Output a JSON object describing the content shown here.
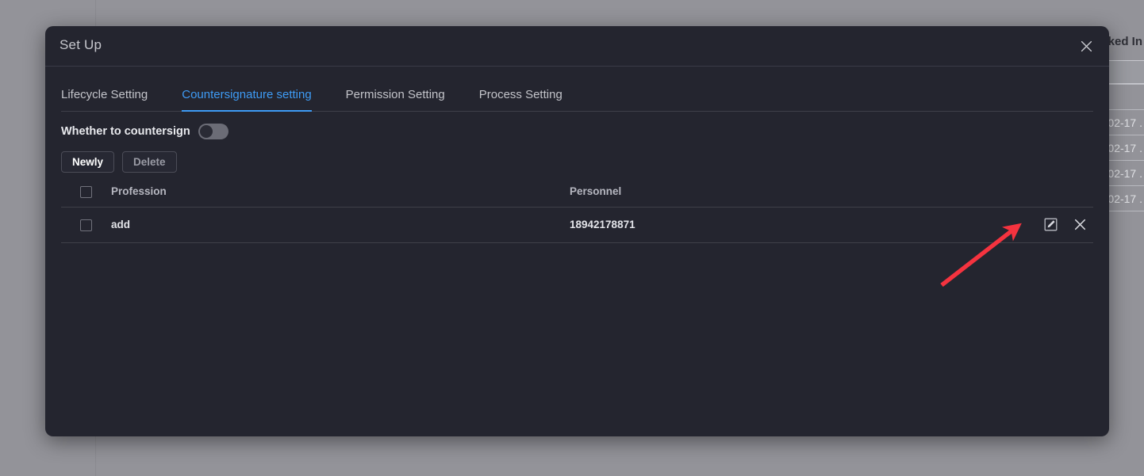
{
  "background": {
    "table": {
      "header": "ked In",
      "rows": [
        "",
        "",
        "02-17 .",
        "02-17 .",
        "02-17 .",
        "02-17 .",
        ""
      ]
    }
  },
  "dialog": {
    "title": "Set Up",
    "close_icon": "close-icon",
    "tabs": [
      {
        "label": "Lifecycle Setting",
        "active": false
      },
      {
        "label": "Countersignature setting",
        "active": true
      },
      {
        "label": "Permission Setting",
        "active": false
      },
      {
        "label": "Process Setting",
        "active": false
      }
    ],
    "countersign": {
      "label": "Whether to countersign",
      "enabled": false
    },
    "buttons": {
      "new_label": "Newly",
      "delete_label": "Delete"
    },
    "table": {
      "columns": [
        "Profession",
        "Personnel"
      ],
      "rows": [
        {
          "profession": "add",
          "personnel": "18942178871"
        }
      ],
      "row_actions": [
        "edit-icon",
        "remove-icon"
      ]
    }
  },
  "colors": {
    "accent": "#3e9bf5",
    "dialog_bg": "#24252f",
    "backdrop": "#939399",
    "annotation": "#f5333f"
  }
}
